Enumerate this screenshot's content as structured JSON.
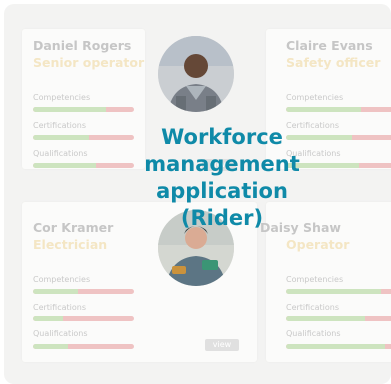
{
  "cards": [
    {
      "name": "Daniel Rogers",
      "role": "Senior operator",
      "metrics": [
        {
          "label": "Competencies",
          "value": 0.72
        },
        {
          "label": "Certifications",
          "value": 0.55
        },
        {
          "label": "Qualifications",
          "value": 0.62
        }
      ]
    },
    {
      "name": "Claire Evans",
      "role": "Safety officer",
      "metrics": [
        {
          "label": "Competencies",
          "value": 0.68
        },
        {
          "label": "Certifications",
          "value": 0.6
        },
        {
          "label": "Qualifications",
          "value": 0.66
        }
      ]
    },
    {
      "name": "Cor Kramer",
      "role": "Electrician",
      "metrics": [
        {
          "label": "Competencies",
          "value": 0.45
        },
        {
          "label": "Certifications",
          "value": 0.3
        },
        {
          "label": "Qualifications",
          "value": 0.35
        }
      ]
    },
    {
      "name": "Daisy Shaw",
      "role": "Operator",
      "metrics": [
        {
          "label": "Competencies",
          "value": 0.86
        },
        {
          "label": "Certifications",
          "value": 0.72
        },
        {
          "label": "Qualifications",
          "value": 0.9
        }
      ]
    }
  ],
  "view_label": "view",
  "overlay_title": "Workforce management application (Rider)",
  "colors": {
    "accent": "#0f8aa8",
    "bar_good": "#cde4bf",
    "bar_bad": "#efc3c3"
  }
}
